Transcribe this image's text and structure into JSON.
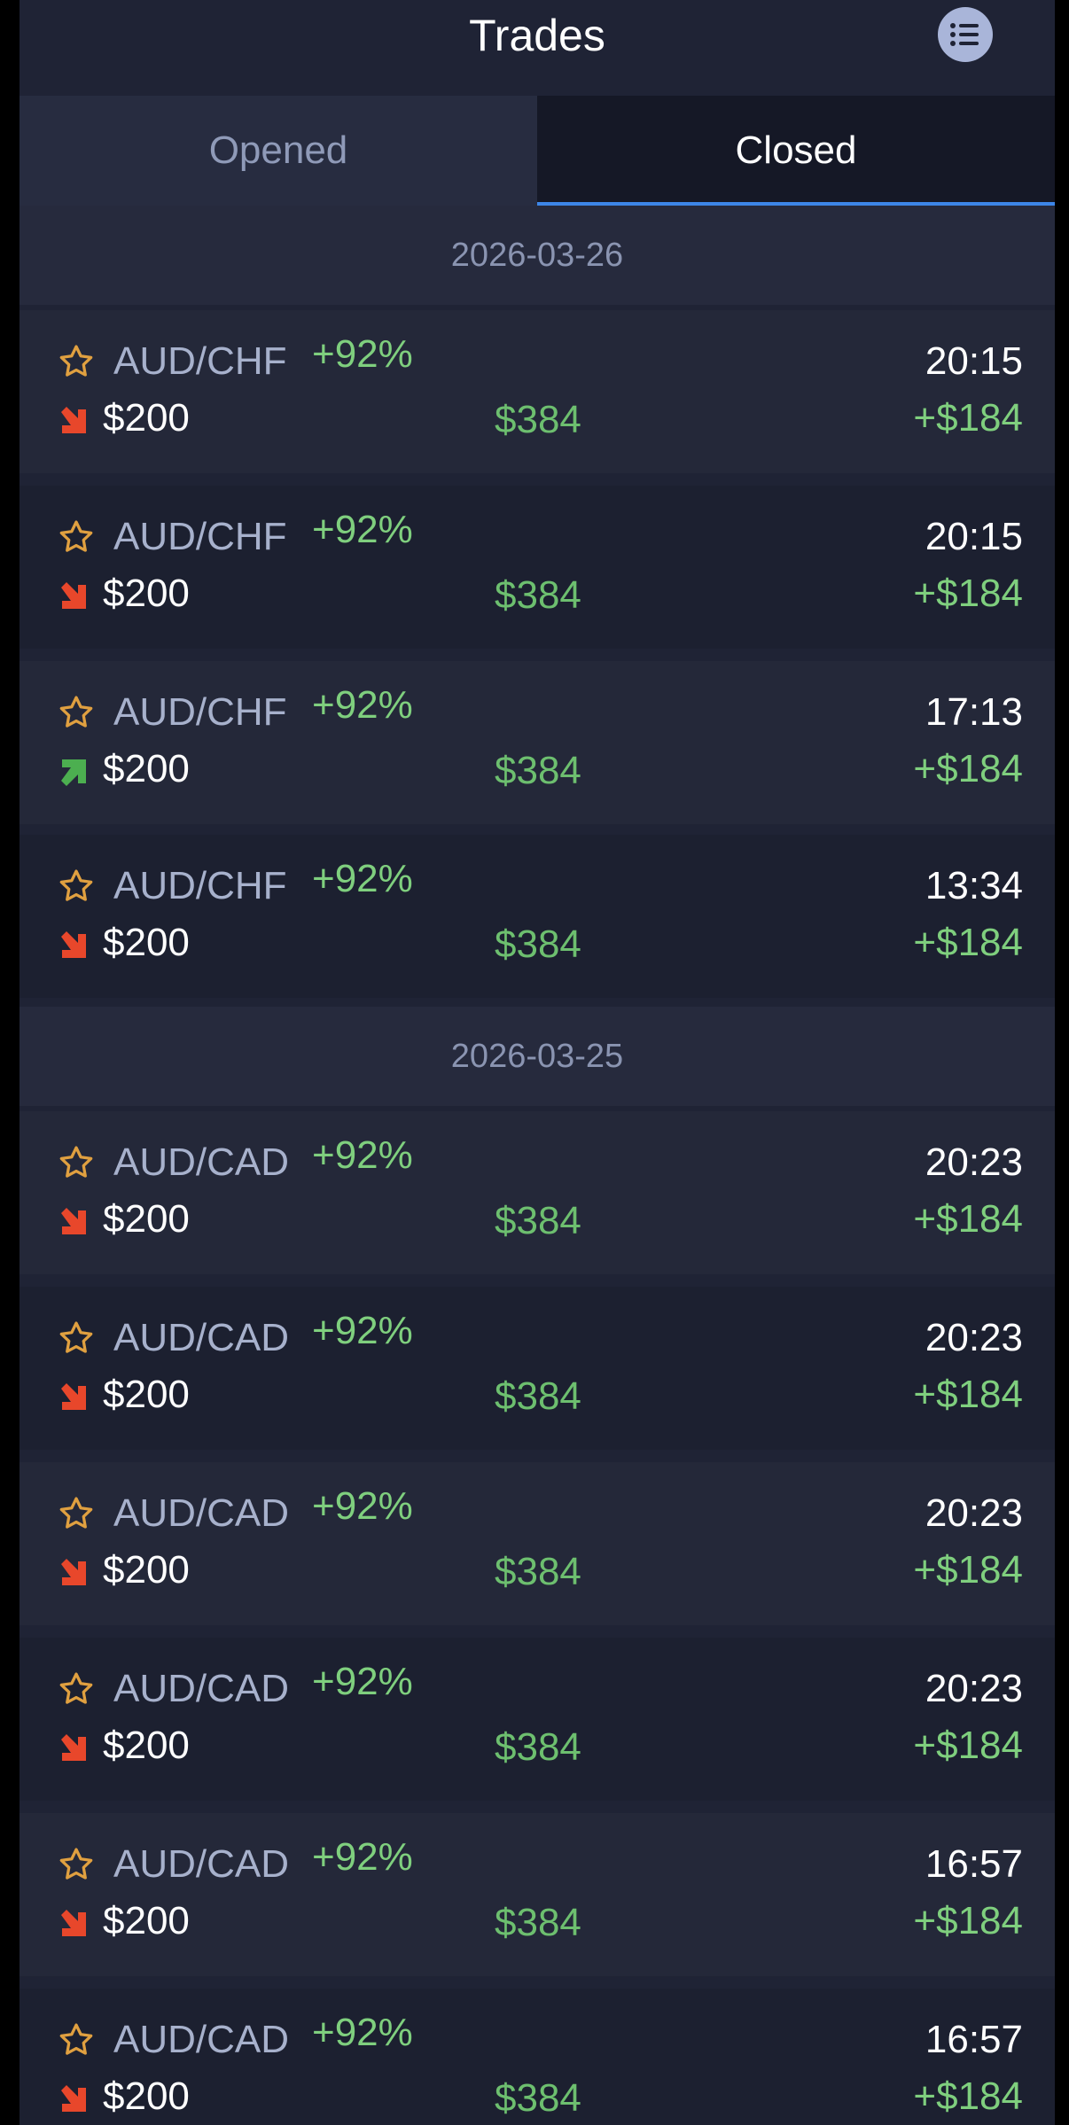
{
  "header": {
    "title": "Trades"
  },
  "tabs": [
    {
      "label": "Opened",
      "active": false
    },
    {
      "label": "Closed",
      "active": true
    }
  ],
  "groups": [
    {
      "date": "2026-03-26",
      "trades": [
        {
          "pair": "AUD/CHF",
          "payout_pct": "+92%",
          "time": "20:15",
          "direction": "down",
          "amount": "$200",
          "payout_amount": "$384",
          "profit": "+$184"
        },
        {
          "pair": "AUD/CHF",
          "payout_pct": "+92%",
          "time": "20:15",
          "direction": "down",
          "amount": "$200",
          "payout_amount": "$384",
          "profit": "+$184"
        },
        {
          "pair": "AUD/CHF",
          "payout_pct": "+92%",
          "time": "17:13",
          "direction": "up",
          "amount": "$200",
          "payout_amount": "$384",
          "profit": "+$184"
        },
        {
          "pair": "AUD/CHF",
          "payout_pct": "+92%",
          "time": "13:34",
          "direction": "down",
          "amount": "$200",
          "payout_amount": "$384",
          "profit": "+$184"
        }
      ]
    },
    {
      "date": "2026-03-25",
      "trades": [
        {
          "pair": "AUD/CAD",
          "payout_pct": "+92%",
          "time": "20:23",
          "direction": "down",
          "amount": "$200",
          "payout_amount": "$384",
          "profit": "+$184"
        },
        {
          "pair": "AUD/CAD",
          "payout_pct": "+92%",
          "time": "20:23",
          "direction": "down",
          "amount": "$200",
          "payout_amount": "$384",
          "profit": "+$184"
        },
        {
          "pair": "AUD/CAD",
          "payout_pct": "+92%",
          "time": "20:23",
          "direction": "down",
          "amount": "$200",
          "payout_amount": "$384",
          "profit": "+$184"
        },
        {
          "pair": "AUD/CAD",
          "payout_pct": "+92%",
          "time": "20:23",
          "direction": "down",
          "amount": "$200",
          "payout_amount": "$384",
          "profit": "+$184"
        },
        {
          "pair": "AUD/CAD",
          "payout_pct": "+92%",
          "time": "16:57",
          "direction": "down",
          "amount": "$200",
          "payout_amount": "$384",
          "profit": "+$184"
        },
        {
          "pair": "AUD/CAD",
          "payout_pct": "+92%",
          "time": "16:57",
          "direction": "down",
          "amount": "$200",
          "payout_amount": "$384",
          "profit": "+$184"
        }
      ]
    }
  ],
  "icons": {
    "menu": "list-icon",
    "favorite": "star-outline-icon",
    "down": "arrow-down-right-icon",
    "up": "arrow-up-right-icon"
  },
  "colors": {
    "background": "#1f2335",
    "up": "#4caf50",
    "down": "#e8472b",
    "star": "#e0a040",
    "positive_text": "#7fcf7e",
    "tab_underline": "#3d86e8"
  }
}
